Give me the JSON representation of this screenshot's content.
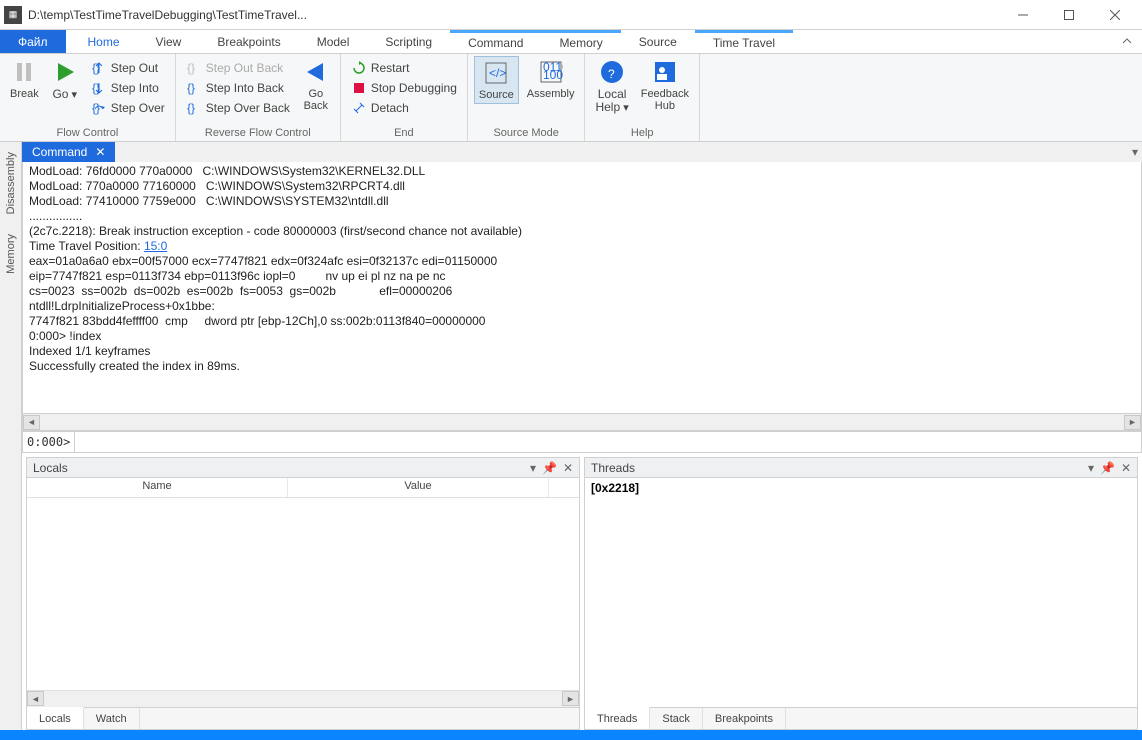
{
  "window": {
    "title": "D:\\temp\\TestTimeTravelDebugging\\TestTimeTravel..."
  },
  "menu": {
    "file": "Файл",
    "home": "Home",
    "view": "View",
    "breakpoints": "Breakpoints",
    "model": "Model",
    "scripting": "Scripting",
    "command": "Command",
    "memory": "Memory",
    "source": "Source",
    "timetravel": "Time Travel"
  },
  "ribbon": {
    "flow": {
      "break": "Break",
      "go": "Go",
      "step_out": "Step Out",
      "step_into": "Step Into",
      "step_over": "Step Over",
      "label": "Flow Control"
    },
    "rflow": {
      "step_out_back": "Step Out Back",
      "step_into_back": "Step Into Back",
      "step_over_back": "Step Over Back",
      "go_back": "Go\nBack",
      "label": "Reverse Flow Control"
    },
    "end": {
      "restart": "Restart",
      "stop": "Stop Debugging",
      "detach": "Detach",
      "label": "End"
    },
    "srcmode": {
      "source": "Source",
      "assembly": "Assembly",
      "label": "Source Mode"
    },
    "help": {
      "local": "Local\nHelp",
      "feedback": "Feedback\nHub",
      "label": "Help"
    }
  },
  "side": {
    "disassembly": "Disassembly",
    "memory": "Memory"
  },
  "command_panel": {
    "title": "Command",
    "output_lines": [
      "ModLoad: 76fd0000 770a0000   C:\\WINDOWS\\System32\\KERNEL32.DLL",
      "ModLoad: 770a0000 77160000   C:\\WINDOWS\\System32\\RPCRT4.dll",
      "ModLoad: 77410000 7759e000   C:\\WINDOWS\\SYSTEM32\\ntdll.dll",
      "................",
      "(2c7c.2218): Break instruction exception - code 80000003 (first/second chance not available)",
      "Time Travel Position: ",
      "eax=01a0a6a0 ebx=00f57000 ecx=7747f821 edx=0f324afc esi=0f32137c edi=01150000",
      "eip=7747f821 esp=0113f734 ebp=0113f96c iopl=0         nv up ei pl nz na pe nc",
      "cs=0023  ss=002b  ds=002b  es=002b  fs=0053  gs=002b             efl=00000206",
      "ntdll!LdrpInitializeProcess+0x1bbe:",
      "7747f821 83bdd4feffff00  cmp     dword ptr [ebp-12Ch],0 ss:002b:0113f840=00000000",
      "0:000> !index",
      "Indexed 1/1 keyframes",
      "Successfully created the index in 89ms.",
      ""
    ],
    "position_link": "15:0",
    "prompt": "0:000>"
  },
  "locals": {
    "title": "Locals",
    "col_name": "Name",
    "col_value": "Value",
    "footer_tabs": [
      "Locals",
      "Watch"
    ]
  },
  "threads": {
    "title": "Threads",
    "items": [
      "[0x2218]"
    ],
    "footer_tabs": [
      "Threads",
      "Stack",
      "Breakpoints"
    ]
  }
}
